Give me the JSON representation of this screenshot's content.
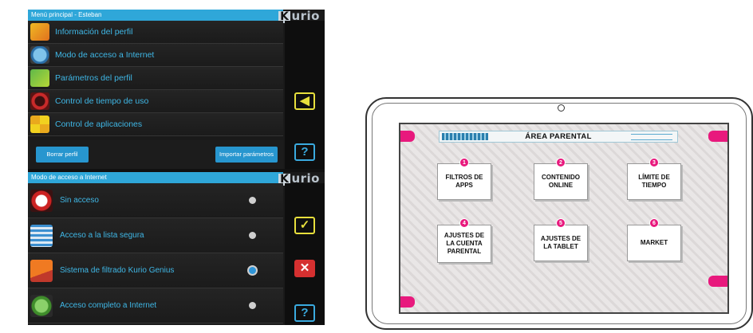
{
  "brand": {
    "logo_k": "K",
    "logo_rest": "urio"
  },
  "screen1": {
    "header": "Menú principal - Esteban",
    "menu": [
      {
        "label": "Información del perfil",
        "icon": "profile-info-icon"
      },
      {
        "label": "Modo de acceso a Internet",
        "icon": "globe-icon"
      },
      {
        "label": "Parámetros del perfil",
        "icon": "profile-settings-icon"
      },
      {
        "label": "Control de tiempo de uso",
        "icon": "clock-icon"
      },
      {
        "label": "Control de aplicaciones",
        "icon": "apps-grid-icon"
      }
    ],
    "delete_button": "Borrar perfil",
    "import_button": "Importar parámetros",
    "side_back": "◀",
    "side_help": "?"
  },
  "screen2": {
    "header": "Modo de acceso a Internet",
    "options": [
      {
        "label": "Sin acceso",
        "icon": "no-access-icon",
        "selected": false
      },
      {
        "label": "Acceso a la lista segura",
        "icon": "safe-list-icon",
        "selected": false
      },
      {
        "label": "Sistema de filtrado Kurio Genius",
        "icon": "filter-icon",
        "selected": true
      },
      {
        "label": "Acceso completo a Internet",
        "icon": "globe-icon",
        "selected": false
      }
    ],
    "side_ok": "✓",
    "side_cancel": "✕",
    "side_help": "?"
  },
  "parental": {
    "title": "ÁREA PARENTAL",
    "tiles": [
      {
        "n": "1",
        "label": "FILTROS DE APPS"
      },
      {
        "n": "2",
        "label": "CONTENIDO ONLINE"
      },
      {
        "n": "3",
        "label": "LÍMITE DE TIEMPO"
      },
      {
        "n": "4",
        "label": "AJUSTES DE LA CUENTA PARENTAL"
      },
      {
        "n": "5",
        "label": "AJUSTES DE LA TABLET"
      },
      {
        "n": "6",
        "label": "MARKET"
      }
    ]
  },
  "colors": {
    "accent": "#2fa7d9",
    "magenta": "#e8197d",
    "yellow": "#e7df3c",
    "red": "#d53030"
  }
}
